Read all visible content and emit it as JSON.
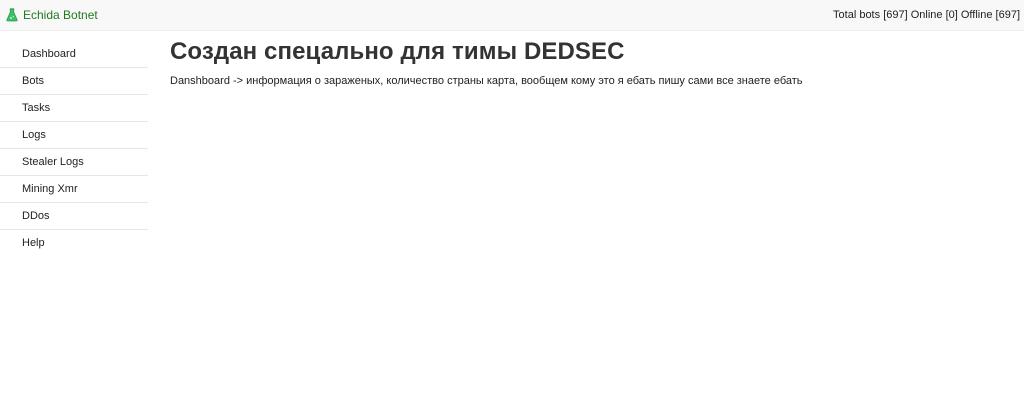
{
  "header": {
    "brand_name": "Echida Botnet",
    "brand_icon": "flask-icon",
    "brand_color": "#1f7a1f",
    "stats": {
      "total_label": "Total bots",
      "total_value": "[697]",
      "online_label": "Online",
      "online_value": "[0]",
      "offline_label": "Offline",
      "offline_value": "[697]"
    }
  },
  "sidebar": {
    "items": [
      {
        "label": "Dashboard"
      },
      {
        "label": "Bots"
      },
      {
        "label": "Tasks"
      },
      {
        "label": "Logs"
      },
      {
        "label": "Stealer Logs"
      },
      {
        "label": "Mining Xmr"
      },
      {
        "label": "DDos"
      },
      {
        "label": "Help"
      }
    ]
  },
  "main": {
    "title": "Создан спецально для тимы DEDSEC",
    "description": "Danshboard -> информация о зараженых, количество страны карта, вообщем кому это я ебать пишу сами все знаете ебать"
  }
}
